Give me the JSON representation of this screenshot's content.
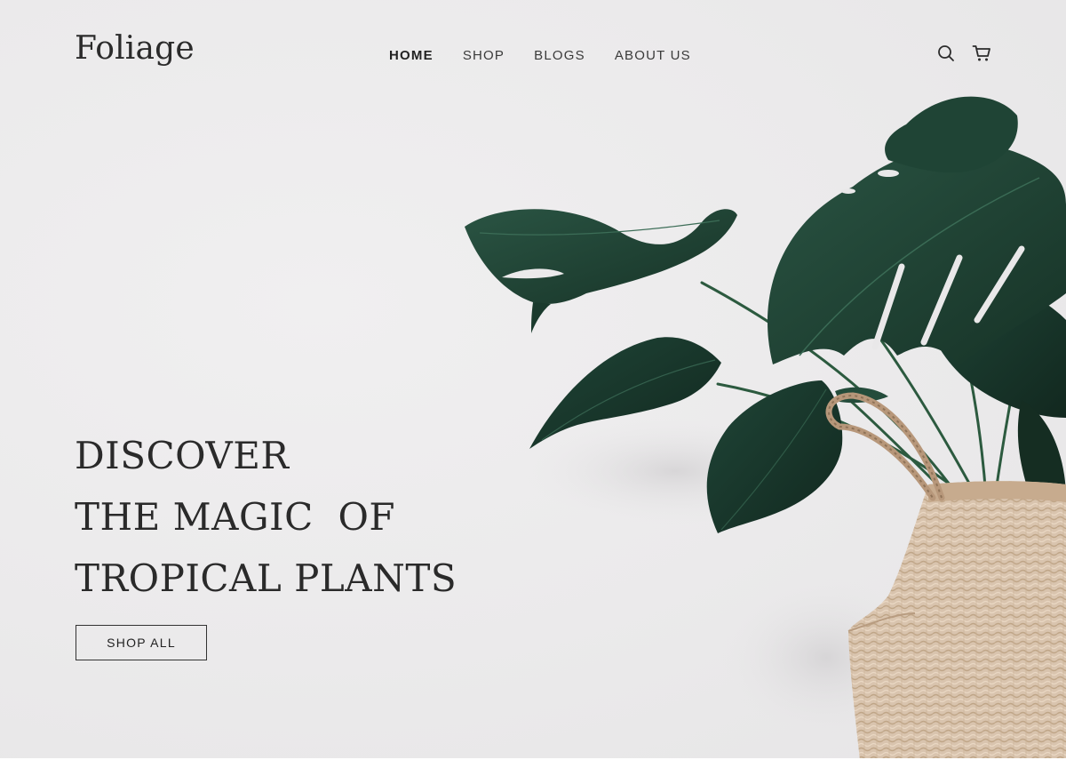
{
  "brand": {
    "logo_text": "Foliage"
  },
  "nav": {
    "items": [
      {
        "label": "HOME",
        "active": true
      },
      {
        "label": "SHOP",
        "active": false
      },
      {
        "label": "BLOGS",
        "active": false
      },
      {
        "label": "ABOUT US",
        "active": false
      }
    ]
  },
  "header_icons": [
    "search-icon",
    "cart-icon"
  ],
  "hero": {
    "headline_lines": [
      "DISCOVER",
      "THE MAGIC  OF",
      "TROPICAL PLANTS"
    ],
    "cta_label": "SHOP ALL",
    "image_subject": "monstera plant in woven basket"
  },
  "colors": {
    "background": "#ebeaeb",
    "text": "#2a2a2a",
    "leaf_dark": "#1d3d30",
    "leaf_mid": "#234a3a",
    "basket": "#d8c2ab"
  }
}
